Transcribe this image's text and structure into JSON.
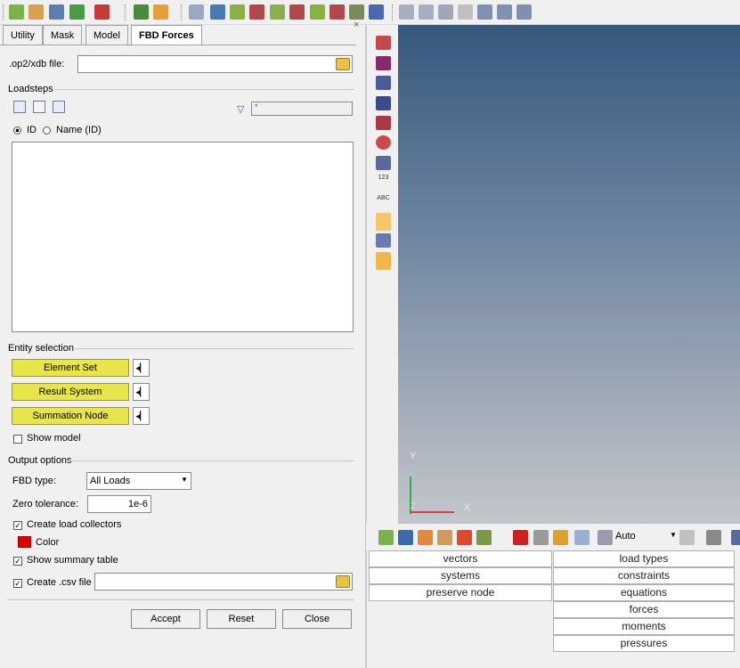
{
  "tabs": [
    "Utility",
    "Mask",
    "Model",
    "FBD Forces"
  ],
  "close_glyph": "×",
  "op2_label": ".op2/xdb file:",
  "loadsteps": {
    "title": "Loadsteps",
    "filter_value": "*",
    "radio_id": "ID",
    "radio_name": "Name (ID)"
  },
  "entity_selection": {
    "title": "Entity selection",
    "buttons": [
      "Element Set",
      "Result System",
      "Summation Node"
    ],
    "show_model": "Show model"
  },
  "output_options": {
    "title": "Output options",
    "fbd_type_label": "FBD type:",
    "fbd_type_value": "All Loads",
    "zero_tol_label": "Zero tolerance:",
    "zero_tol_value": "1e-6",
    "create_collectors": "Create load collectors",
    "color_label": "Color",
    "color_swatch": "#e00000",
    "show_summary": "Show summary table",
    "create_csv": "Create .csv file"
  },
  "actions": [
    "Accept",
    "Reset",
    "Close"
  ],
  "axis": {
    "y": "Y",
    "x": "X",
    "z": "Z"
  },
  "bottom_toolbar": {
    "auto_value": "Auto"
  },
  "bottom_grid": {
    "col1": [
      "vectors",
      "systems",
      "preserve node"
    ],
    "col2": [
      "load types",
      "constraints",
      "equations",
      "forces",
      "moments",
      "pressures"
    ]
  }
}
